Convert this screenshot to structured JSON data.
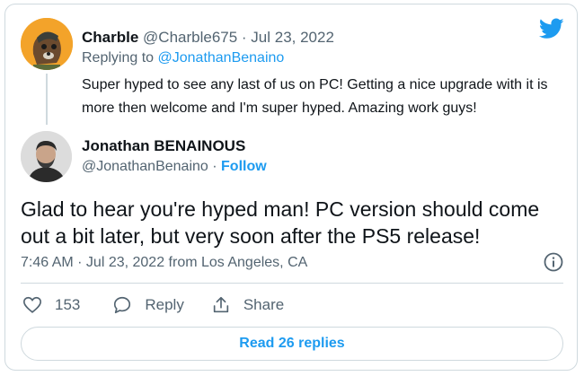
{
  "reply_tweet": {
    "name": "Charble",
    "handle": "@Charble675",
    "separator": " · ",
    "date": "Jul 23, 2022",
    "replying_prefix": "Replying to ",
    "replying_to": "@JonathanBenaino",
    "text": "Super hyped to see any last of us on PC! Getting a nice upgrade with it is more then welcome and I'm super hyped. Amazing work guys!"
  },
  "main_tweet": {
    "author_name": "Jonathan BENAINOUS",
    "author_handle": "@JonathanBenaino",
    "separator": " · ",
    "follow_label": "Follow",
    "text": "Glad to hear you're hyped man! PC version should come out a bit later, but very soon after the PS5 release!",
    "timestamp": "7:46 AM · Jul 23, 2022 from Los Angeles, CA"
  },
  "actions": {
    "like_count": "153",
    "reply_label": "Reply",
    "share_label": "Share"
  },
  "read_replies_label": "Read 26 replies",
  "icons": {
    "brand": "twitter-bird-icon",
    "info": "info-icon",
    "like": "heart-icon",
    "reply": "speech-bubble-icon",
    "share": "share-arrow-icon"
  },
  "colors": {
    "accent": "#1d9bf0",
    "text": "#0f1419",
    "muted": "#536471",
    "border": "#cfd9de"
  }
}
